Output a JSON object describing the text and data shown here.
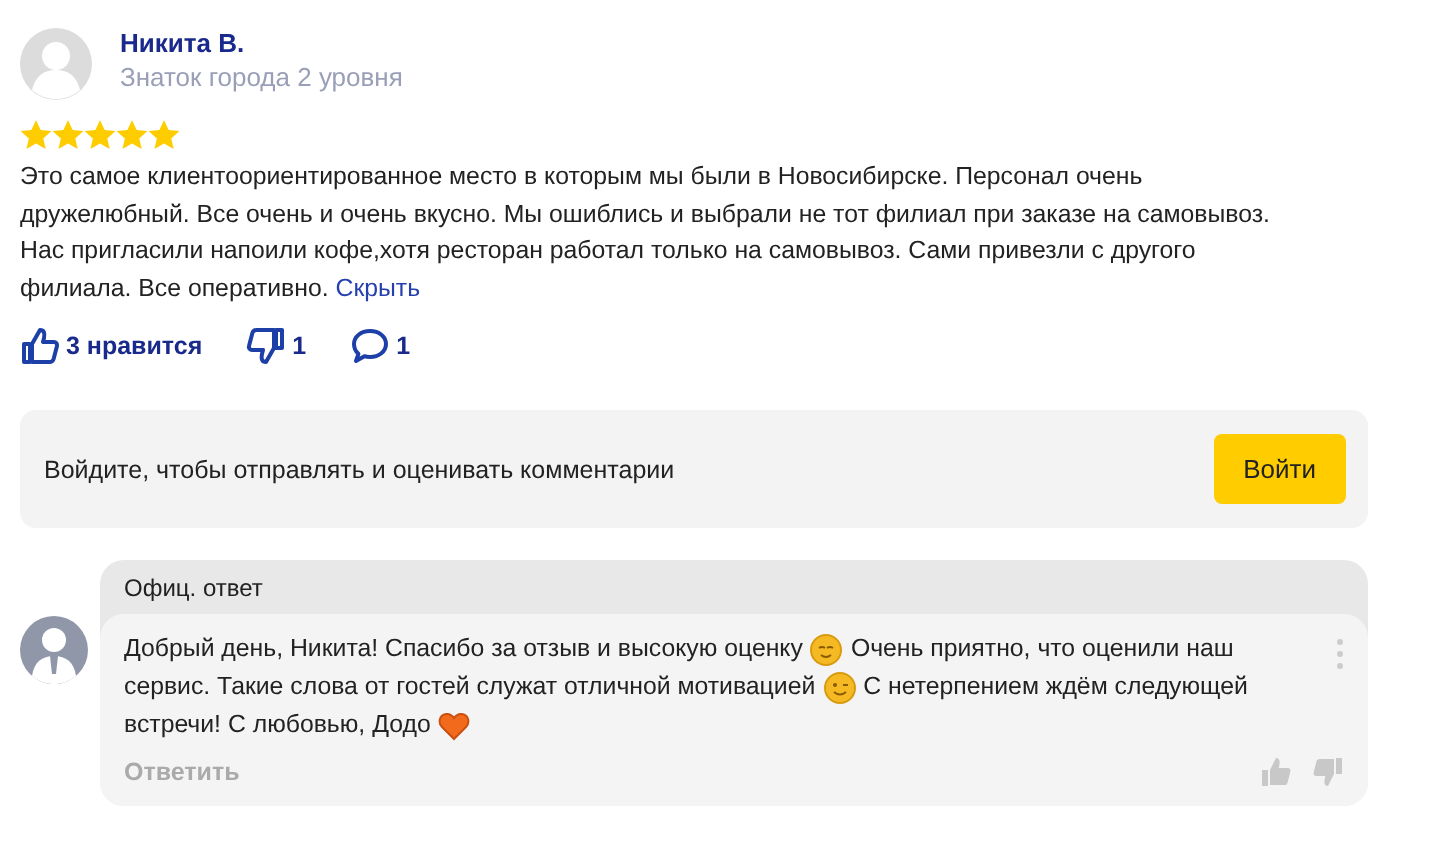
{
  "review": {
    "author": "Никита В.",
    "badge": "Знаток города 2 уровня",
    "stars": 5,
    "text": "Это самое клиентоориентированное место в которым мы были в Новосибирске. Персонал очень дружелюбный. Все очень и очень вкусно. Мы ошиблись и выбрали не тот филиал при заказе на самовывоз. Нас пригласили напоили кофе,хотя ресторан работал только на самовывоз. Сами привезли с другого филиала. Все оперативно.",
    "collapse_link": "Скрыть",
    "likes": "3 нравится",
    "dislikes": "1",
    "comments": "1"
  },
  "login_prompt": {
    "text": "Войдите, чтобы отправлять и оценивать комментарии",
    "button": "Войти"
  },
  "official_reply": {
    "header": "Офиц. ответ",
    "message": [
      [
        {
          "kind": "text",
          "text": "Добрый день, Никита! Спасибо за отзыв и высокую оценку"
        },
        {
          "kind": "smile"
        },
        {
          "kind": "text",
          "text": "Очень приятно, что оценили наш"
        }
      ],
      [
        {
          "kind": "text",
          "text": "сервис. Такие слова от гостей служат отличной мотивацией"
        },
        {
          "kind": "wink"
        },
        {
          "kind": "text",
          "text": "С нетерпением ждём следующей"
        }
      ],
      [
        {
          "kind": "text",
          "text": "встречи! С любовью, Додо"
        },
        {
          "kind": "heart"
        }
      ]
    ],
    "reply_button": "Ответить"
  }
}
